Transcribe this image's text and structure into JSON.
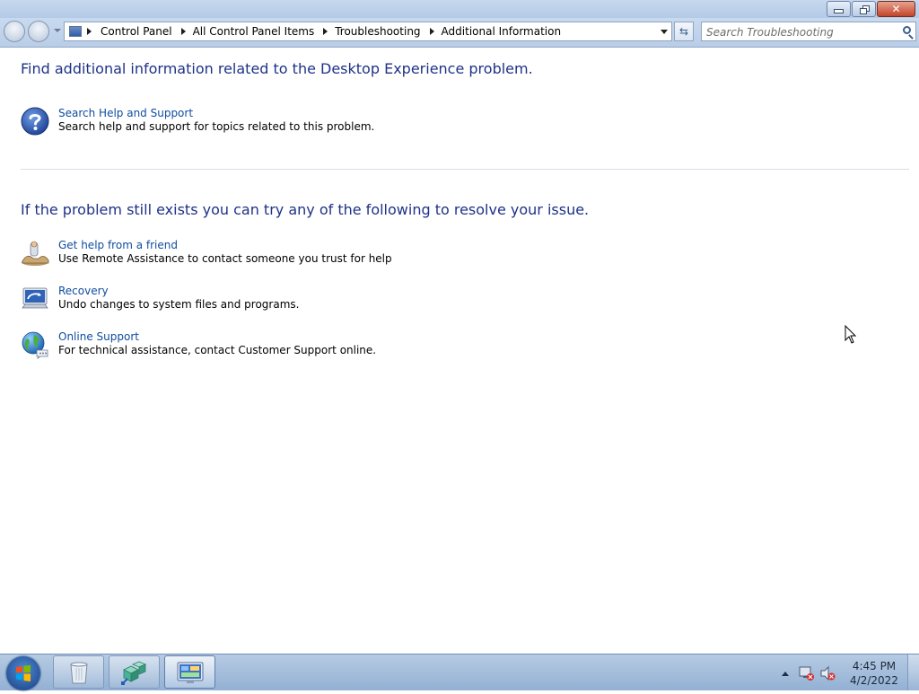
{
  "window": {
    "breadcrumb": [
      "Control Panel",
      "All Control Panel Items",
      "Troubleshooting",
      "Additional Information"
    ],
    "search_placeholder": "Search Troubleshooting"
  },
  "content": {
    "heading1": "Find additional information related to the Desktop Experience problem.",
    "search_help": {
      "link": "Search Help and Support",
      "description": "Search help and support for topics related to this problem.",
      "icon": "help-question-icon"
    },
    "heading2": "If the problem still exists you can try any of the following to resolve your issue.",
    "options": [
      {
        "link": "Get help from a friend",
        "description": "Use Remote Assistance to contact someone you trust for help",
        "icon": "remote-assistance-icon"
      },
      {
        "link": "Recovery",
        "description": "Undo changes to system files and programs.",
        "icon": "recovery-icon"
      },
      {
        "link": "Online Support",
        "description": "For technical assistance, contact Customer Support online.",
        "icon": "online-support-globe-icon"
      }
    ]
  },
  "taskbar": {
    "time": "4:45 PM",
    "date": "4/2/2022",
    "pinned": [
      "recycle-bin-icon",
      "package-cubes-icon",
      "control-panel-icon"
    ]
  },
  "colors": {
    "link": "#0f4da0",
    "heading": "#1e3287",
    "taskbar": "#a9c1df"
  }
}
